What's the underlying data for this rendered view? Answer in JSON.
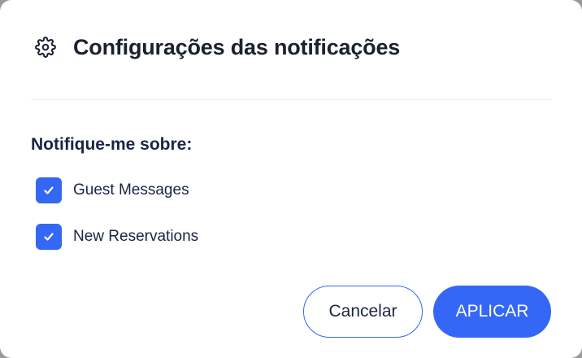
{
  "dialog": {
    "title": "Configurações das notificações",
    "title_icon": "gear-icon"
  },
  "notify": {
    "label": "Notifique-me sobre:",
    "options": [
      {
        "label": "Guest Messages",
        "checked": true
      },
      {
        "label": "New Reservations",
        "checked": true
      }
    ]
  },
  "actions": {
    "cancel_label": "Cancelar",
    "apply_label": "APLICAR"
  },
  "colors": {
    "accent": "#3467f5",
    "text": "#1b2543"
  }
}
